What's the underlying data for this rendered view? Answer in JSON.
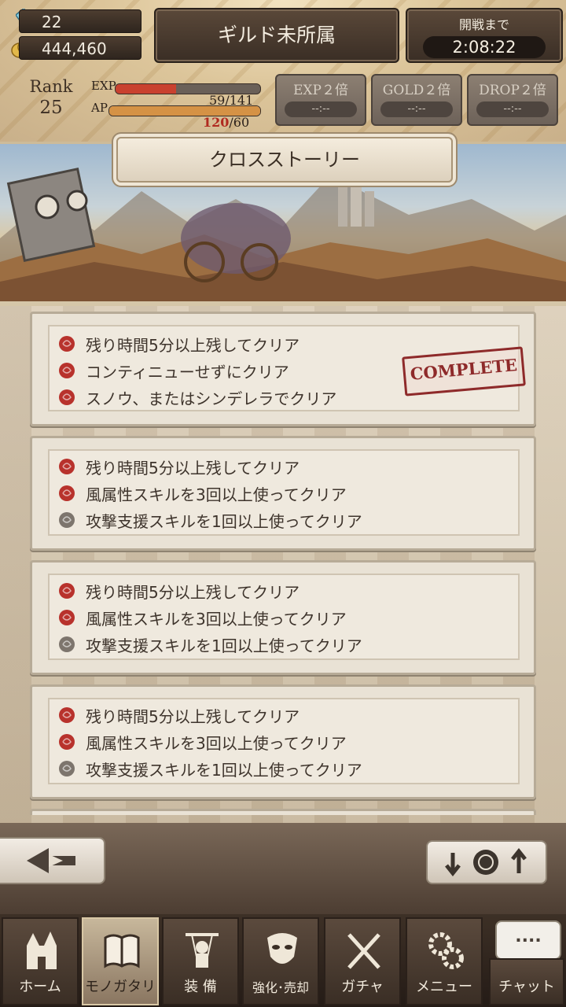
{
  "hud": {
    "gems": "22",
    "gold": "444,460",
    "guild_label": "ギルド未所属",
    "battle_label": "開戦まで",
    "battle_timer": "2:08:22",
    "rank_label": "Rank",
    "rank_value": "25",
    "exp_label": "EXP",
    "exp_value": "59/141",
    "exp_fraction": 0.42,
    "ap_label": "AP",
    "ap_current": "120",
    "ap_max": "/60",
    "ap_fraction": 1.0,
    "boosts": [
      {
        "title": "EXP２倍",
        "time": "--:--"
      },
      {
        "title": "GOLD２倍",
        "time": "--:--"
      },
      {
        "title": "DROP２倍",
        "time": "--:--"
      }
    ]
  },
  "header": {
    "title": "クロスストーリー"
  },
  "missions": [
    {
      "conditions": [
        "残り時間5分以上残してクリア",
        "コンティニューせずにクリア",
        "スノウ、またはシンデレラでクリア"
      ],
      "achieved": [
        true,
        true,
        true
      ],
      "stamp": "COMPLETE"
    },
    {
      "conditions": [
        "残り時間5分以上残してクリア",
        "風属性スキルを3回以上使ってクリア",
        "攻撃支援スキルを1回以上使ってクリア"
      ],
      "achieved": [
        true,
        true,
        false
      ],
      "stamp": ""
    },
    {
      "conditions": [
        "残り時間5分以上残してクリア",
        "風属性スキルを3回以上使ってクリア",
        "攻撃支援スキルを1回以上使ってクリア"
      ],
      "achieved": [
        true,
        true,
        false
      ],
      "stamp": ""
    },
    {
      "conditions": [
        "残り時間5分以上残してクリア",
        "風属性スキルを3回以上使ってクリア",
        "攻撃支援スキルを1回以上使ってクリア"
      ],
      "achieved": [
        true,
        true,
        false
      ],
      "stamp": ""
    }
  ],
  "colors": {
    "rose_active": "#b8322c",
    "rose_inactive": "#7d756d",
    "exp_bar": "#c9412f",
    "ap_bar": "#d59245"
  },
  "nav": {
    "tabs": [
      {
        "label": "ホーム",
        "icon": "castle-icon"
      },
      {
        "label": "モノガタリ",
        "icon": "book-icon"
      },
      {
        "label": "装 備",
        "icon": "puppet-icon"
      },
      {
        "label": "強化･売却",
        "icon": "mask-icon"
      },
      {
        "label": "ガチャ",
        "icon": "swords-icon"
      },
      {
        "label": "メニュー",
        "icon": "gears-icon"
      }
    ],
    "chat_label": "チャット",
    "chat_bubble": "....",
    "active_tab": 1
  }
}
